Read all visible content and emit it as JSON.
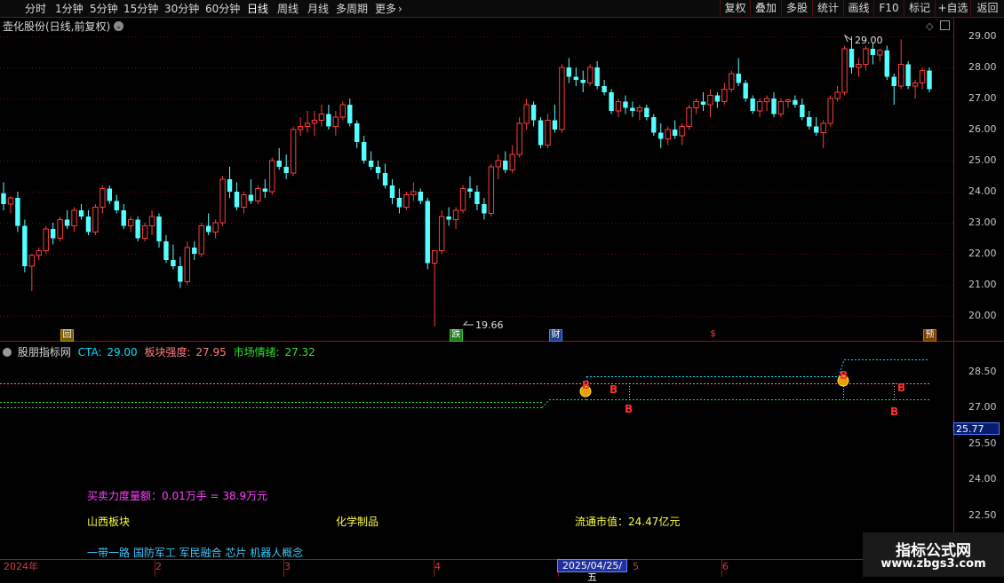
{
  "toolbar": {
    "periods": [
      "分时",
      "1分钟",
      "5分钟",
      "15分钟",
      "30分钟",
      "60分钟",
      "日线",
      "周线",
      "月线",
      "多周期",
      "更多"
    ],
    "active_period": "日线",
    "right_buttons": [
      "复权",
      "叠加",
      "多股",
      "统计",
      "画线",
      "F10",
      "标记",
      "+自选",
      "返回"
    ]
  },
  "stock": {
    "title": "壶化股份(日线,前复权)",
    "high_label": "29.00",
    "low_label": "19.66"
  },
  "price_axis": [
    "29.00",
    "28.00",
    "27.00",
    "26.00",
    "25.00",
    "24.00",
    "23.00",
    "22.00",
    "21.00",
    "20.00"
  ],
  "event_markers": [
    "回",
    "跌",
    "财",
    "$",
    "预"
  ],
  "indicator": {
    "name": "股朋指标网",
    "cta_label": "CTA:",
    "cta_value": "29.00",
    "sector_label": "板块强度:",
    "sector_value": "27.95",
    "mood_label": "市场情绪:",
    "mood_value": "27.32",
    "axis": [
      "28.50",
      "27.00",
      "25.50",
      "24.00",
      "22.50"
    ],
    "cursor_value": "25.77",
    "signals": [
      "B",
      "B",
      "B",
      "B",
      "B",
      "B"
    ],
    "colors": {
      "cta": "#00e0ff",
      "sector": "#ff8080",
      "mood": "#30e030"
    }
  },
  "info": {
    "power": "买卖力度量额：0.01万手 = 38.9万元",
    "sector": "山西板块",
    "industry": "化学制品",
    "market_value": "流通市值：24.47亿元",
    "concepts": "一带一路 国防军工 军民融合 芯片 机器人概念"
  },
  "date_axis": [
    "2024年",
    "2",
    "3",
    "4",
    "5",
    "6"
  ],
  "cursor_date": "2025/04/25/五",
  "watermark": {
    "line1": "指标公式网",
    "line2": "www.zbgs3.com"
  },
  "ohlc": [
    [
      23.95,
      24.3,
      23.4,
      23.6
    ],
    [
      23.6,
      23.85,
      23.3,
      23.8
    ],
    [
      23.8,
      24.0,
      22.7,
      22.9
    ],
    [
      22.9,
      23.1,
      21.4,
      21.6
    ],
    [
      21.6,
      22.0,
      20.8,
      21.95
    ],
    [
      21.95,
      22.2,
      21.8,
      22.1
    ],
    [
      22.1,
      22.9,
      22.0,
      22.8
    ],
    [
      22.8,
      23.0,
      22.3,
      22.5
    ],
    [
      22.5,
      23.2,
      22.4,
      23.1
    ],
    [
      23.1,
      23.4,
      22.8,
      22.9
    ],
    [
      22.9,
      23.5,
      22.7,
      23.4
    ],
    [
      23.4,
      23.6,
      23.1,
      23.2
    ],
    [
      23.2,
      23.4,
      22.6,
      22.7
    ],
    [
      22.7,
      23.6,
      22.6,
      23.5
    ],
    [
      23.5,
      24.2,
      23.3,
      24.1
    ],
    [
      24.1,
      24.2,
      23.6,
      23.7
    ],
    [
      23.7,
      23.9,
      23.3,
      23.4
    ],
    [
      23.4,
      23.6,
      22.8,
      22.9
    ],
    [
      22.9,
      23.2,
      22.7,
      23.1
    ],
    [
      23.1,
      23.2,
      22.4,
      22.5
    ],
    [
      22.5,
      23.0,
      22.4,
      22.9
    ],
    [
      22.9,
      23.4,
      22.6,
      23.2
    ],
    [
      23.2,
      23.3,
      22.2,
      22.4
    ],
    [
      22.4,
      22.6,
      21.7,
      21.8
    ],
    [
      21.8,
      22.3,
      21.5,
      21.6
    ],
    [
      21.6,
      21.9,
      20.9,
      21.1
    ],
    [
      21.1,
      22.4,
      21.0,
      22.2
    ],
    [
      22.2,
      22.4,
      21.8,
      22.0
    ],
    [
      22.0,
      23.0,
      21.9,
      22.9
    ],
    [
      22.9,
      23.3,
      22.6,
      22.7
    ],
    [
      22.7,
      23.1,
      22.5,
      23.0
    ],
    [
      23.0,
      24.5,
      22.9,
      24.4
    ],
    [
      24.4,
      24.8,
      23.8,
      24.0
    ],
    [
      24.0,
      24.3,
      23.4,
      23.5
    ],
    [
      23.5,
      24.0,
      23.3,
      23.9
    ],
    [
      23.9,
      24.4,
      23.6,
      23.7
    ],
    [
      23.7,
      24.2,
      23.6,
      24.1
    ],
    [
      24.1,
      24.4,
      23.8,
      24.0
    ],
    [
      24.0,
      25.1,
      23.9,
      25.0
    ],
    [
      25.0,
      25.4,
      24.7,
      24.8
    ],
    [
      24.8,
      25.2,
      24.4,
      24.6
    ],
    [
      24.6,
      26.1,
      24.5,
      26.0
    ],
    [
      26.0,
      26.4,
      25.8,
      26.1
    ],
    [
      26.1,
      26.6,
      25.9,
      26.2
    ],
    [
      26.2,
      26.6,
      25.8,
      26.3
    ],
    [
      26.3,
      26.8,
      26.1,
      26.5
    ],
    [
      26.5,
      26.8,
      26.0,
      26.1
    ],
    [
      26.1,
      26.6,
      25.8,
      26.4
    ],
    [
      26.4,
      26.9,
      26.3,
      26.8
    ],
    [
      26.8,
      27.0,
      26.1,
      26.2
    ],
    [
      26.2,
      26.3,
      25.4,
      25.6
    ],
    [
      25.6,
      25.8,
      24.9,
      25.0
    ],
    [
      25.0,
      25.3,
      24.7,
      24.8
    ],
    [
      24.8,
      25.0,
      24.4,
      24.6
    ],
    [
      24.6,
      24.9,
      24.1,
      24.2
    ],
    [
      24.2,
      24.4,
      23.6,
      23.8
    ],
    [
      23.8,
      24.1,
      23.3,
      23.5
    ],
    [
      23.5,
      24.0,
      23.4,
      23.9
    ],
    [
      23.9,
      24.3,
      23.7,
      24.0
    ],
    [
      24.0,
      24.1,
      23.6,
      23.7
    ],
    [
      23.7,
      23.8,
      21.5,
      21.7
    ],
    [
      21.7,
      22.0,
      19.66,
      22.1
    ],
    [
      22.1,
      23.4,
      22.0,
      23.2
    ],
    [
      23.2,
      23.5,
      22.9,
      23.1
    ],
    [
      23.1,
      23.5,
      22.8,
      23.4
    ],
    [
      23.4,
      24.2,
      23.3,
      24.1
    ],
    [
      24.1,
      24.5,
      23.8,
      24.0
    ],
    [
      24.0,
      24.2,
      23.4,
      23.6
    ],
    [
      23.6,
      23.8,
      23.1,
      23.3
    ],
    [
      23.3,
      24.9,
      23.2,
      24.8
    ],
    [
      24.8,
      25.2,
      24.4,
      25.0
    ],
    [
      25.0,
      25.3,
      24.6,
      24.7
    ],
    [
      24.7,
      25.5,
      24.6,
      25.2
    ],
    [
      25.2,
      26.4,
      25.1,
      26.2
    ],
    [
      26.2,
      27.0,
      26.0,
      26.8
    ],
    [
      26.8,
      26.9,
      26.1,
      26.3
    ],
    [
      26.3,
      26.4,
      25.4,
      25.5
    ],
    [
      25.5,
      26.5,
      25.4,
      26.3
    ],
    [
      26.3,
      26.8,
      25.9,
      26.0
    ],
    [
      26.0,
      28.1,
      25.9,
      28.0
    ],
    [
      28.0,
      28.3,
      27.5,
      27.7
    ],
    [
      27.7,
      28.0,
      27.4,
      27.6
    ],
    [
      27.6,
      27.9,
      27.2,
      27.5
    ],
    [
      27.5,
      28.1,
      27.4,
      28.0
    ],
    [
      28.0,
      28.2,
      27.3,
      27.4
    ],
    [
      27.4,
      27.6,
      27.1,
      27.2
    ],
    [
      27.2,
      27.3,
      26.5,
      26.6
    ],
    [
      26.6,
      27.0,
      26.4,
      26.9
    ],
    [
      26.9,
      27.1,
      26.5,
      26.7
    ],
    [
      26.7,
      26.9,
      26.4,
      26.6
    ],
    [
      26.6,
      26.8,
      26.3,
      26.7
    ],
    [
      26.7,
      26.8,
      26.3,
      26.4
    ],
    [
      26.4,
      26.5,
      25.8,
      25.9
    ],
    [
      25.9,
      26.2,
      25.4,
      25.7
    ],
    [
      25.7,
      26.1,
      25.5,
      26.0
    ],
    [
      26.0,
      26.3,
      25.7,
      25.8
    ],
    [
      25.8,
      26.2,
      25.5,
      26.1
    ],
    [
      26.1,
      26.8,
      26.0,
      26.7
    ],
    [
      26.7,
      27.0,
      26.5,
      26.9
    ],
    [
      26.9,
      27.2,
      26.6,
      26.8
    ],
    [
      26.8,
      27.3,
      26.4,
      27.1
    ],
    [
      27.1,
      27.2,
      26.7,
      26.9
    ],
    [
      26.9,
      27.5,
      26.8,
      27.3
    ],
    [
      27.3,
      27.9,
      27.2,
      27.8
    ],
    [
      27.8,
      28.3,
      27.4,
      27.5
    ],
    [
      27.5,
      27.6,
      26.9,
      27.0
    ],
    [
      27.0,
      27.1,
      26.5,
      26.6
    ],
    [
      26.6,
      27.0,
      26.4,
      26.9
    ],
    [
      26.9,
      27.1,
      26.6,
      27.0
    ],
    [
      27.0,
      27.2,
      26.4,
      26.5
    ],
    [
      26.5,
      27.0,
      26.4,
      26.9
    ],
    [
      26.9,
      27.0,
      26.7,
      26.95
    ],
    [
      26.95,
      27.1,
      26.7,
      26.8
    ],
    [
      26.8,
      27.0,
      26.3,
      26.4
    ],
    [
      26.4,
      26.6,
      26.0,
      26.1
    ],
    [
      26.1,
      26.4,
      25.8,
      25.9
    ],
    [
      25.9,
      26.3,
      25.4,
      26.2
    ],
    [
      26.2,
      27.1,
      26.1,
      27.0
    ],
    [
      27.0,
      27.4,
      26.9,
      27.2
    ],
    [
      27.2,
      28.7,
      27.1,
      28.6
    ],
    [
      28.6,
      29.0,
      27.8,
      28.0
    ],
    [
      28.0,
      28.3,
      27.7,
      28.1
    ],
    [
      28.1,
      28.7,
      27.9,
      28.6
    ],
    [
      28.6,
      28.8,
      28.1,
      28.4
    ],
    [
      28.4,
      28.6,
      28.2,
      28.55
    ],
    [
      28.55,
      28.7,
      27.6,
      27.7
    ],
    [
      27.7,
      27.8,
      26.8,
      27.4
    ],
    [
      27.4,
      28.9,
      27.3,
      28.1
    ],
    [
      28.1,
      28.2,
      27.3,
      27.4
    ],
    [
      27.4,
      27.6,
      27.0,
      27.5
    ],
    [
      27.5,
      28.0,
      27.3,
      27.9
    ],
    [
      27.9,
      28.0,
      27.2,
      27.3
    ]
  ]
}
